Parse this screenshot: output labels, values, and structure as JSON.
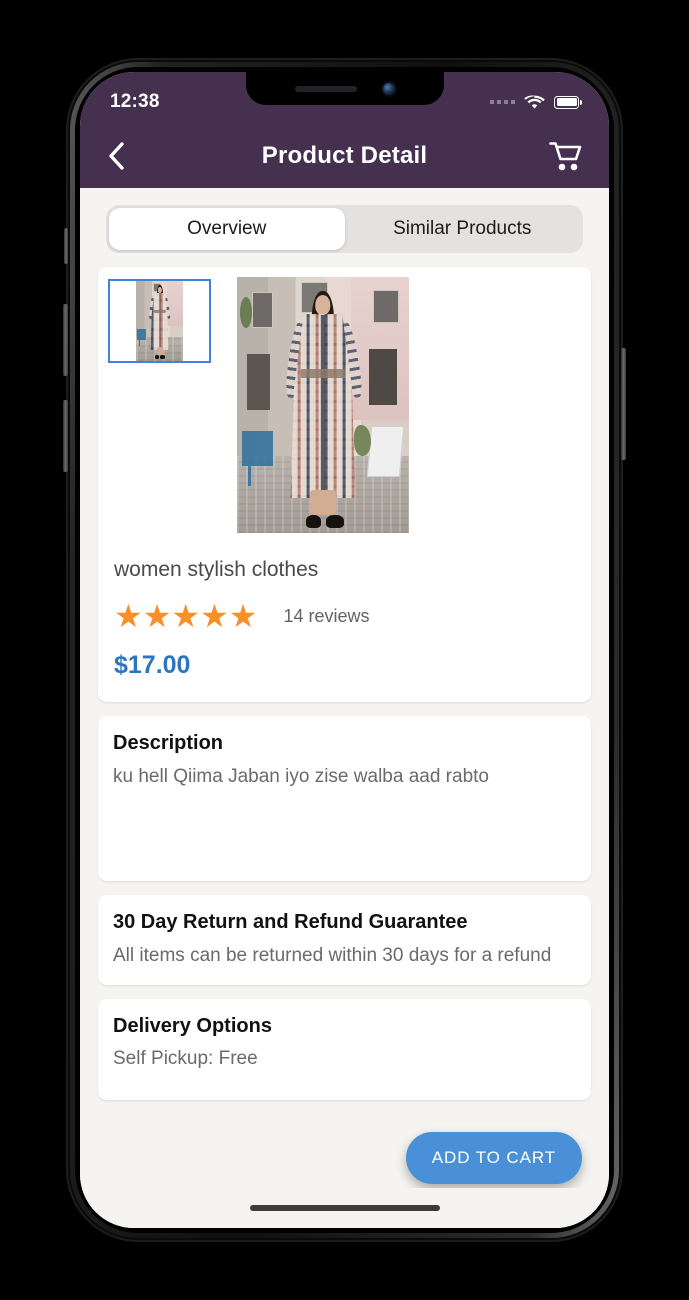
{
  "status_bar": {
    "time": "12:38",
    "signal_icon": "signal-dots-icon",
    "wifi_icon": "wifi-icon",
    "battery_icon": "battery-full-icon"
  },
  "app_bar": {
    "back_icon": "chevron-left-icon",
    "title": "Product Detail",
    "cart_icon": "shopping-cart-icon"
  },
  "tabs": [
    {
      "label": "Overview",
      "active": true
    },
    {
      "label": "Similar Products",
      "active": false
    }
  ],
  "gallery": {
    "thumbnail_alt": "women stylish clothes thumbnail",
    "main_image_alt": "woman wearing plaid maxi shirt dress on a cobblestone street",
    "selected_index": 0
  },
  "product": {
    "title": "women stylish clothes",
    "rating_stars": "★★★★★",
    "rating_value": 5,
    "reviews": "14 reviews",
    "price": "$17.00"
  },
  "description": {
    "heading": "Description",
    "body": "ku hell Qiima Jaban iyo zise walba aad rabto"
  },
  "guarantee": {
    "heading": "30 Day Return and Refund Guarantee",
    "body": "All items can be returned within 30 days for a refund"
  },
  "delivery": {
    "heading": "Delivery Options",
    "line1": "Self Pickup:  Free"
  },
  "actions": {
    "add_to_cart": "ADD TO CART"
  },
  "colors": {
    "app_bar": "#453050",
    "price": "#2b77bd",
    "star": "#f79028",
    "primary_button": "#4a90d9",
    "page_background": "#f5f4f1",
    "selected_thumb_border": "#3e82e0"
  }
}
